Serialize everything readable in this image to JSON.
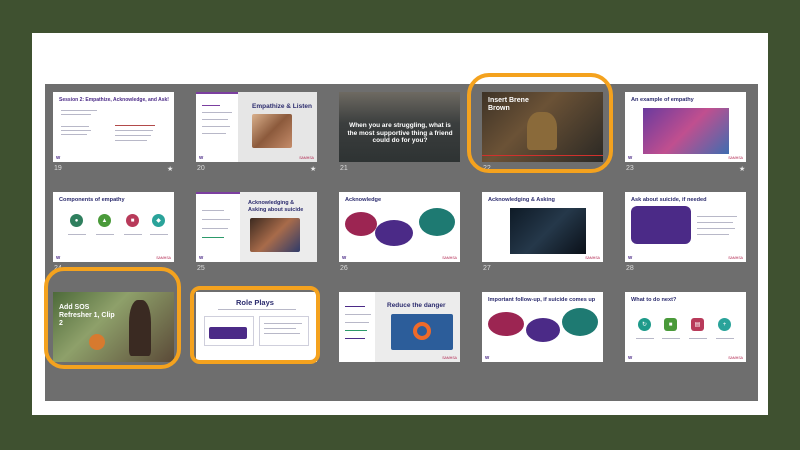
{
  "slides": {
    "s19": {
      "num": "19",
      "title": "Session 2: Empathize, Acknowledge, and Ask!"
    },
    "s20": {
      "num": "20",
      "title": "Empathize & Listen"
    },
    "s21": {
      "num": "21",
      "caption": "When you are struggling, what is the most supportive thing a friend could do for you?"
    },
    "s22": {
      "num": "22",
      "title": "Insert Brene Brown"
    },
    "s23": {
      "num": "23",
      "title": "An example of empathy"
    },
    "s24": {
      "num": "24",
      "title": "Components of empathy"
    },
    "s25": {
      "num": "25",
      "title": "Acknowledging & Asking about suicide"
    },
    "s26": {
      "num": "26",
      "title": "Acknowledge"
    },
    "s27": {
      "num": "27",
      "title": "Acknowledging & Asking"
    },
    "s28": {
      "num": "28",
      "title": "Ask about suicide, if needed"
    },
    "s29": {
      "title": "Add SOS Refresher 1, Clip 2"
    },
    "s30": {
      "title": "Role Plays"
    },
    "s31": {
      "title": "Reduce the danger"
    },
    "s32": {
      "title": "Important follow-up, if suicide comes up"
    },
    "s33": {
      "title": "What to do next?"
    }
  },
  "logo": {
    "w": "W",
    "brand": "SAMHSA"
  },
  "star_glyph": "★",
  "colors": {
    "accent_outline": "#f4a21e",
    "bg": "#3f5130",
    "sorter": "#6e6e6e"
  }
}
